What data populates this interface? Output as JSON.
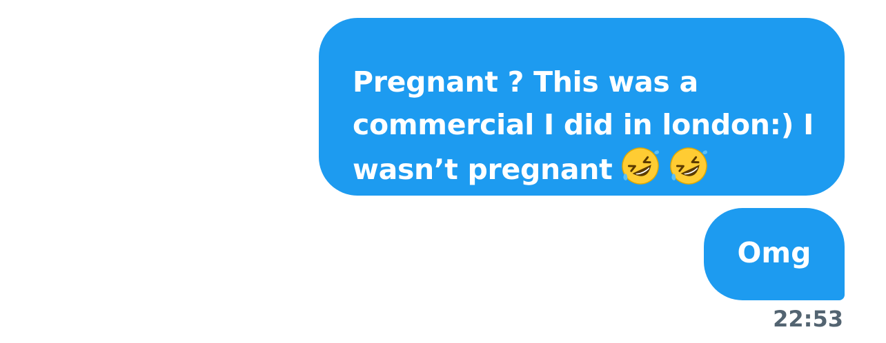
{
  "messages": [
    {
      "text": "Pregnant ? This was a commercial I did in london:) I wasn’t pregnant",
      "emojis": [
        "rofl-emoji",
        "rofl-emoji"
      ]
    },
    {
      "text": "Omg"
    }
  ],
  "timestamp": "22:53",
  "colors": {
    "bubble": "#1d9bf0",
    "bubble_text": "#ffffff",
    "timestamp": "#536471",
    "background": "#ffffff"
  }
}
